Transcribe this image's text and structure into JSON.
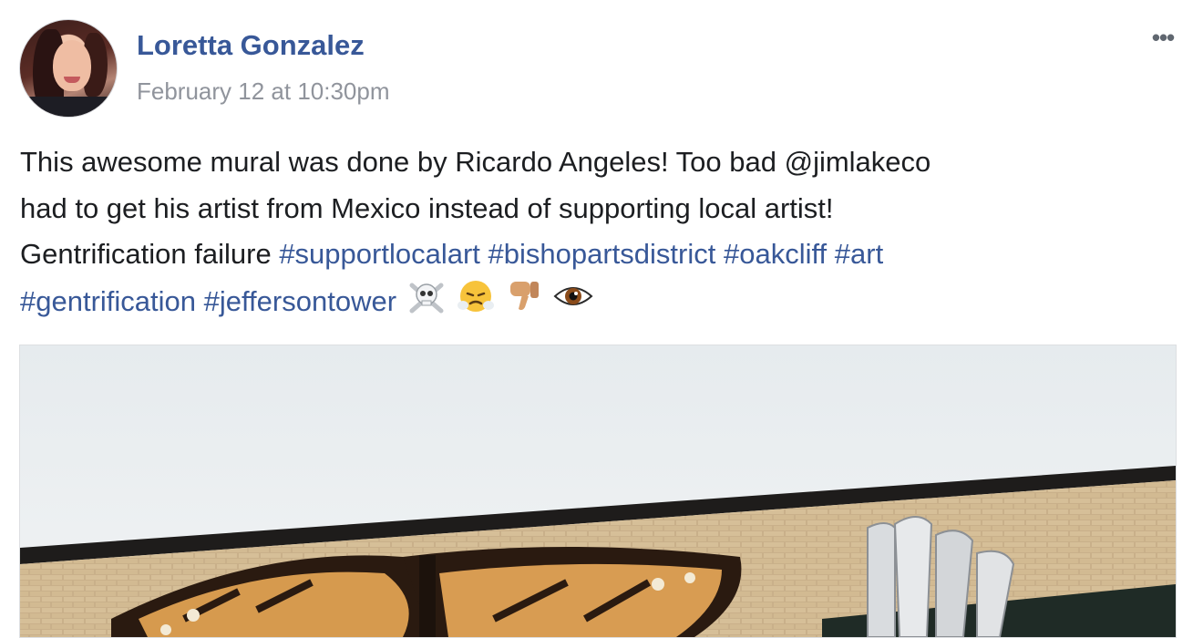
{
  "post": {
    "author": "Loretta Gonzalez",
    "timestamp": "February 12 at 10:30pm",
    "more_glyph": "•••",
    "text_plain_1": "This awesome mural was done by Ricardo Angeles! Too bad @jimlakeco",
    "text_plain_2": "had to get his artist from Mexico instead of supporting local artist!",
    "text_plain_3": "Gentrification failure",
    "hashtags": [
      "#supportlocalart",
      "#bishopartsdistrict",
      "#oakcliff",
      "#art",
      "#gentrification",
      "#jeffersontower"
    ],
    "emojis": [
      "skull-and-crossbones",
      "face-with-steam",
      "thumbs-down",
      "eye"
    ]
  },
  "colors": {
    "link": "#385898",
    "secondary_text": "#90949c",
    "body_text": "#1c1e21"
  }
}
